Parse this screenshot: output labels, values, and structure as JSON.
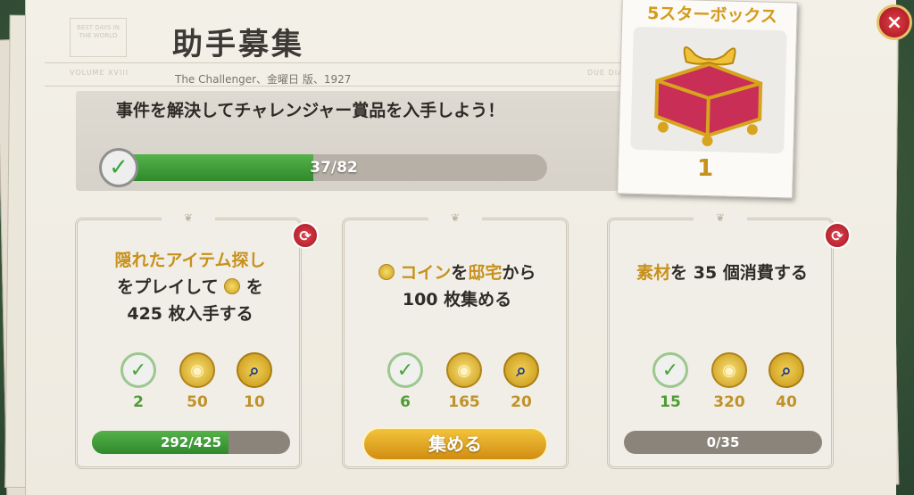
{
  "header": {
    "title": "助手募集",
    "subtitle": "The Challenger、金曜日 版、1927"
  },
  "masthead": {
    "left_box": "BEST DAYS IN THE WORLD",
    "left_side": "VOLUME XVIII",
    "right_side": "DUE DIAMOS"
  },
  "main_goal": {
    "text": "事件を解決してチャレンジャー賞品を入手しよう！",
    "progress_text": "37/82",
    "progress_fraction": 0.451
  },
  "reward_box": {
    "title": "5スターボックス",
    "count": "1"
  },
  "close_button": {
    "icon": "close-icon",
    "label": "×"
  },
  "tasks": [
    {
      "text_parts": {
        "hl1": "隠れたアイテム探し",
        "t1": "をプレイして",
        "t2": "を",
        "t3": "425 枚入手する"
      },
      "rewards": [
        {
          "icon": "check-plus-icon",
          "value": "2",
          "color": "#4f9c36"
        },
        {
          "icon": "coin-icon",
          "value": "50",
          "color": "#c1922a"
        },
        {
          "icon": "magnifier-badge-icon",
          "value": "10",
          "color": "#c1922a"
        }
      ],
      "progress_text": "292/425",
      "progress_fraction": 0.687
    },
    {
      "text_parts": {
        "hl1": "コイン",
        "t1": "を",
        "hl2": "邸宅",
        "t2": "から 100 枚集める"
      },
      "rewards": [
        {
          "icon": "check-plus-icon",
          "value": "6",
          "color": "#4f9c36"
        },
        {
          "icon": "coin-icon",
          "value": "165",
          "color": "#c1922a"
        },
        {
          "icon": "magnifier-badge-icon",
          "value": "20",
          "color": "#c1922a"
        }
      ],
      "button_label": "集める"
    },
    {
      "text_parts": {
        "hl1": "素材",
        "t1": "を 35 個消費する"
      },
      "rewards": [
        {
          "icon": "check-plus-icon",
          "value": "15",
          "color": "#4f9c36"
        },
        {
          "icon": "coin-icon",
          "value": "320",
          "color": "#c1922a"
        },
        {
          "icon": "magnifier-badge-icon",
          "value": "40",
          "color": "#c1922a"
        }
      ],
      "progress_text": "0/35",
      "progress_fraction": 0
    }
  ]
}
